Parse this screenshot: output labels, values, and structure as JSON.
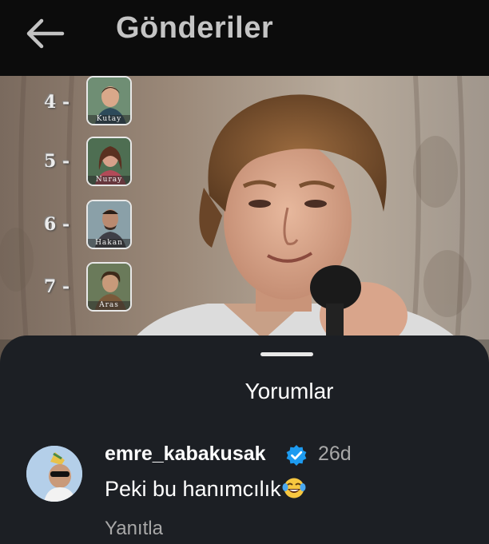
{
  "header": {
    "title": "Gönderiler"
  },
  "post": {
    "ranking": [
      {
        "number": "4 -",
        "name": "Kutay"
      },
      {
        "number": "5 -",
        "name": "Nuray"
      },
      {
        "number": "6 -",
        "name": "Hakan"
      },
      {
        "number": "7 -",
        "name": "Aras"
      }
    ]
  },
  "comments_sheet": {
    "title": "Yorumlar",
    "comments": [
      {
        "username": "emre_kabakusak",
        "verified": true,
        "timestamp": "26d",
        "text": "Peki bu hanımcılık",
        "emoji": "face-with-tears-of-joy-icon",
        "reply_label": "Yanıtla"
      }
    ]
  },
  "colors": {
    "header_bg": "#0c0c0c",
    "sheet_bg": "#1c1f24",
    "verified_blue": "#1d9bf0",
    "secondary_text": "#a8a8a8"
  }
}
